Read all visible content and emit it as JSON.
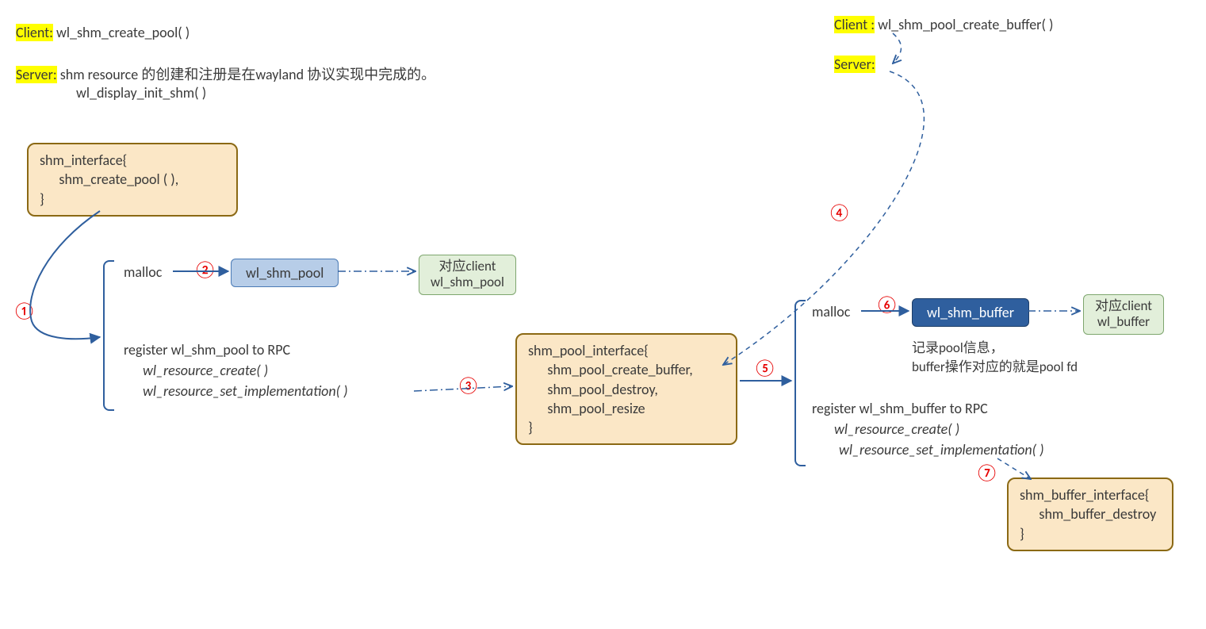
{
  "top_left": {
    "client_label": "Client:",
    "client_call": " wl_shm_create_pool( )",
    "server_label": "Server:",
    "server_line1": " shm resource 的创建和注册是在wayland 协议实现中完成的。",
    "server_line2": "wl_display_init_shm( )"
  },
  "top_right": {
    "client_label": "Client :",
    "client_call": " wl_shm_pool_create_buffer( )",
    "server_label": "Server:"
  },
  "shm_interface": {
    "line1": "shm_interface{",
    "line2": "      shm_create_pool ( ),",
    "line3": "}"
  },
  "left_block": {
    "malloc": "malloc",
    "wl_shm_pool": "wl_shm_pool",
    "client_match_l1": "对应client",
    "client_match_l2": "wl_shm_pool",
    "register_title": "register wl_shm_pool to RPC",
    "rc_create": "wl_resource_create( )",
    "rc_set_impl": "wl_resource_set_implementation( )"
  },
  "shm_pool_interface": {
    "line1": "shm_pool_interface{",
    "line2": "      shm_pool_create_buffer,",
    "line3": "      shm_pool_destroy,",
    "line4": "      shm_pool_resize",
    "line5": "}"
  },
  "right_block": {
    "malloc": "malloc",
    "wl_shm_buffer": "wl_shm_buffer",
    "client_match_l1": "对应client",
    "client_match_l2": "wl_buffer",
    "note_l1": "记录pool信息，",
    "note_l2": "buffer操作对应的就是pool fd",
    "register_title": "register wl_shm_buffer to RPC",
    "rc_create": "wl_resource_create( )",
    "rc_set_impl": "wl_resource_set_implementation( )"
  },
  "shm_buffer_interface": {
    "line1": "shm_buffer_interface{",
    "line2": "      shm_buffer_destroy",
    "line3": "}"
  },
  "numbers": {
    "n1": "①",
    "n2": "②",
    "n3": "③",
    "n4": "④",
    "n5": "⑤",
    "n6": "⑥",
    "n7": "⑦"
  }
}
